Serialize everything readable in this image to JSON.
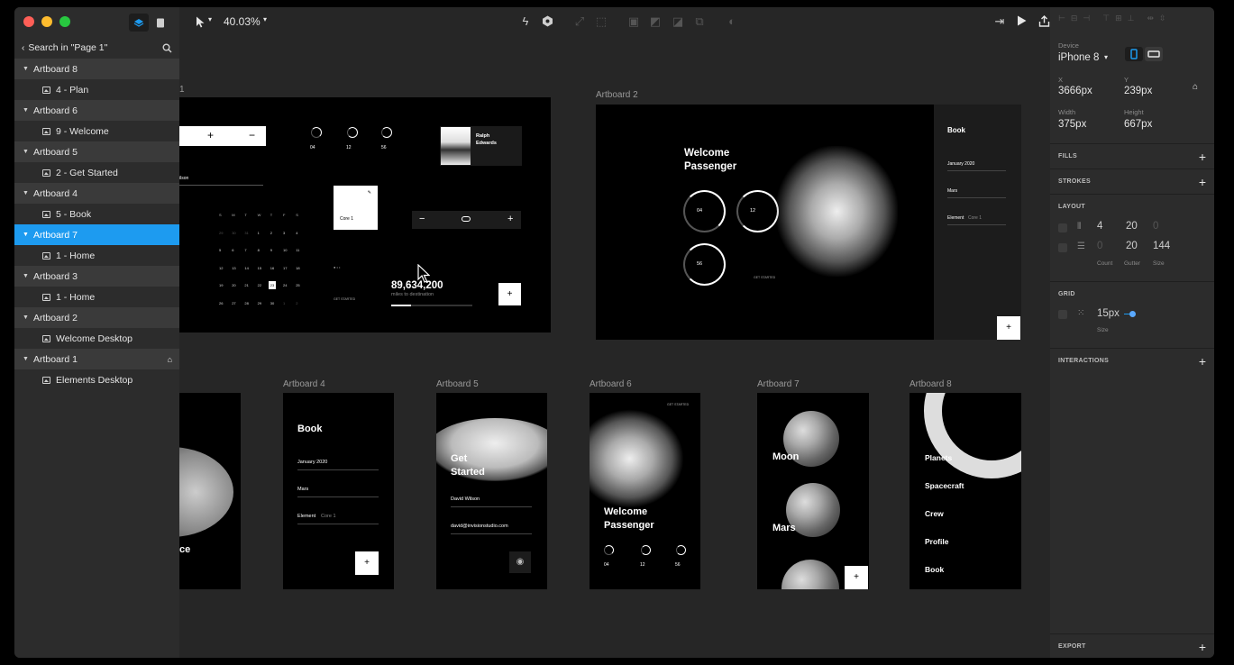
{
  "sidebar": {
    "search_label": "Search in \"Page 1\"",
    "layers": [
      {
        "label": "Artboard 8",
        "type": "group"
      },
      {
        "label": "4 - Plan",
        "type": "child"
      },
      {
        "label": "Artboard 6",
        "type": "group"
      },
      {
        "label": "9 - Welcome",
        "type": "child"
      },
      {
        "label": "Artboard 5",
        "type": "group"
      },
      {
        "label": "2 - Get Started",
        "type": "child"
      },
      {
        "label": "Artboard 4",
        "type": "group"
      },
      {
        "label": "5 - Book",
        "type": "child"
      },
      {
        "label": "Artboard 7",
        "type": "group",
        "selected": true
      },
      {
        "label": "1 - Home",
        "type": "child"
      },
      {
        "label": "Artboard 3",
        "type": "group"
      },
      {
        "label": "1 - Home",
        "type": "child"
      },
      {
        "label": "Artboard 2",
        "type": "group"
      },
      {
        "label": "Welcome Desktop",
        "type": "child"
      },
      {
        "label": "Artboard 1",
        "type": "group",
        "home": true
      },
      {
        "label": "Elements Desktop",
        "type": "child"
      }
    ]
  },
  "toolbar": {
    "zoom": "40.03%"
  },
  "canvas": {
    "artboard1_label": "1",
    "artboard2_label": "Artboard 2",
    "artboard4_label": "Artboard 4",
    "artboard5_label": "Artboard 5",
    "artboard6_label": "Artboard 6",
    "artboard7_label": "Artboard 7",
    "artboard8_label": "Artboard 8",
    "ab1": {
      "name_first": "Ralph",
      "name_last": "Edwards",
      "counts": [
        "04",
        "12",
        "56"
      ],
      "card_label": "Core 1",
      "big_number": "89,634,200",
      "big_caption": "miles to destination",
      "name_fragment": "ilson",
      "get_started": "GET STARTED",
      "calendar_header": [
        "S",
        "M",
        "T",
        "W",
        "T",
        "F",
        "S"
      ],
      "calendar_rows": [
        [
          "29",
          "30",
          "31",
          "1",
          "2",
          "3",
          "4"
        ],
        [
          "5",
          "6",
          "7",
          "8",
          "9",
          "10",
          "11"
        ],
        [
          "12",
          "13",
          "14",
          "15",
          "16",
          "17",
          "18"
        ],
        [
          "19",
          "20",
          "21",
          "22",
          "23",
          "24",
          "25"
        ],
        [
          "26",
          "27",
          "28",
          "29",
          "30",
          "1",
          "2"
        ]
      ]
    },
    "ab2": {
      "welcome_line1": "Welcome",
      "welcome_line2": "Passenger",
      "counts": [
        "04",
        "12",
        "56"
      ],
      "book_title": "Book",
      "date": "January 2020",
      "dest": "Mars",
      "element": "Element",
      "element_val": "Core 1",
      "get_started": "GET STARTED"
    },
    "ab3": {
      "text_fragment": "ce"
    },
    "ab4": {
      "title": "Book",
      "date": "January 2020",
      "dest": "Mars",
      "element": "Element",
      "element_val": "Core 1"
    },
    "ab5": {
      "title_line1": "Get",
      "title_line2": "Started",
      "name": "David Wilson",
      "email": "david@invisionstudio.com"
    },
    "ab6": {
      "get_started": "GET STARTED",
      "welcome_line1": "Welcome",
      "welcome_line2": "Passenger",
      "counts": [
        "04",
        "12",
        "56"
      ]
    },
    "ab7": {
      "moon": "Moon",
      "mars": "Mars"
    },
    "ab8": {
      "items": [
        "Planets",
        "Spacecraft",
        "Crew",
        "Profile",
        "Book"
      ]
    }
  },
  "inspector": {
    "device_label": "Device",
    "device_value": "iPhone 8",
    "x_label": "X",
    "x_value": "3666px",
    "y_label": "Y",
    "y_value": "239px",
    "width_label": "Width",
    "width_value": "375px",
    "height_label": "Height",
    "height_value": "667px",
    "fills": "FILLS",
    "strokes": "STROKES",
    "layout": "LAYOUT",
    "layout_row1": [
      "4",
      "20",
      "0"
    ],
    "layout_row2": [
      "0",
      "20",
      "144"
    ],
    "layout_captions": [
      "Count",
      "Gutter",
      "Size"
    ],
    "grid": "GRID",
    "grid_value": "15px",
    "grid_caption": "Size",
    "interactions": "INTERACTIONS",
    "export": "EXPORT"
  }
}
